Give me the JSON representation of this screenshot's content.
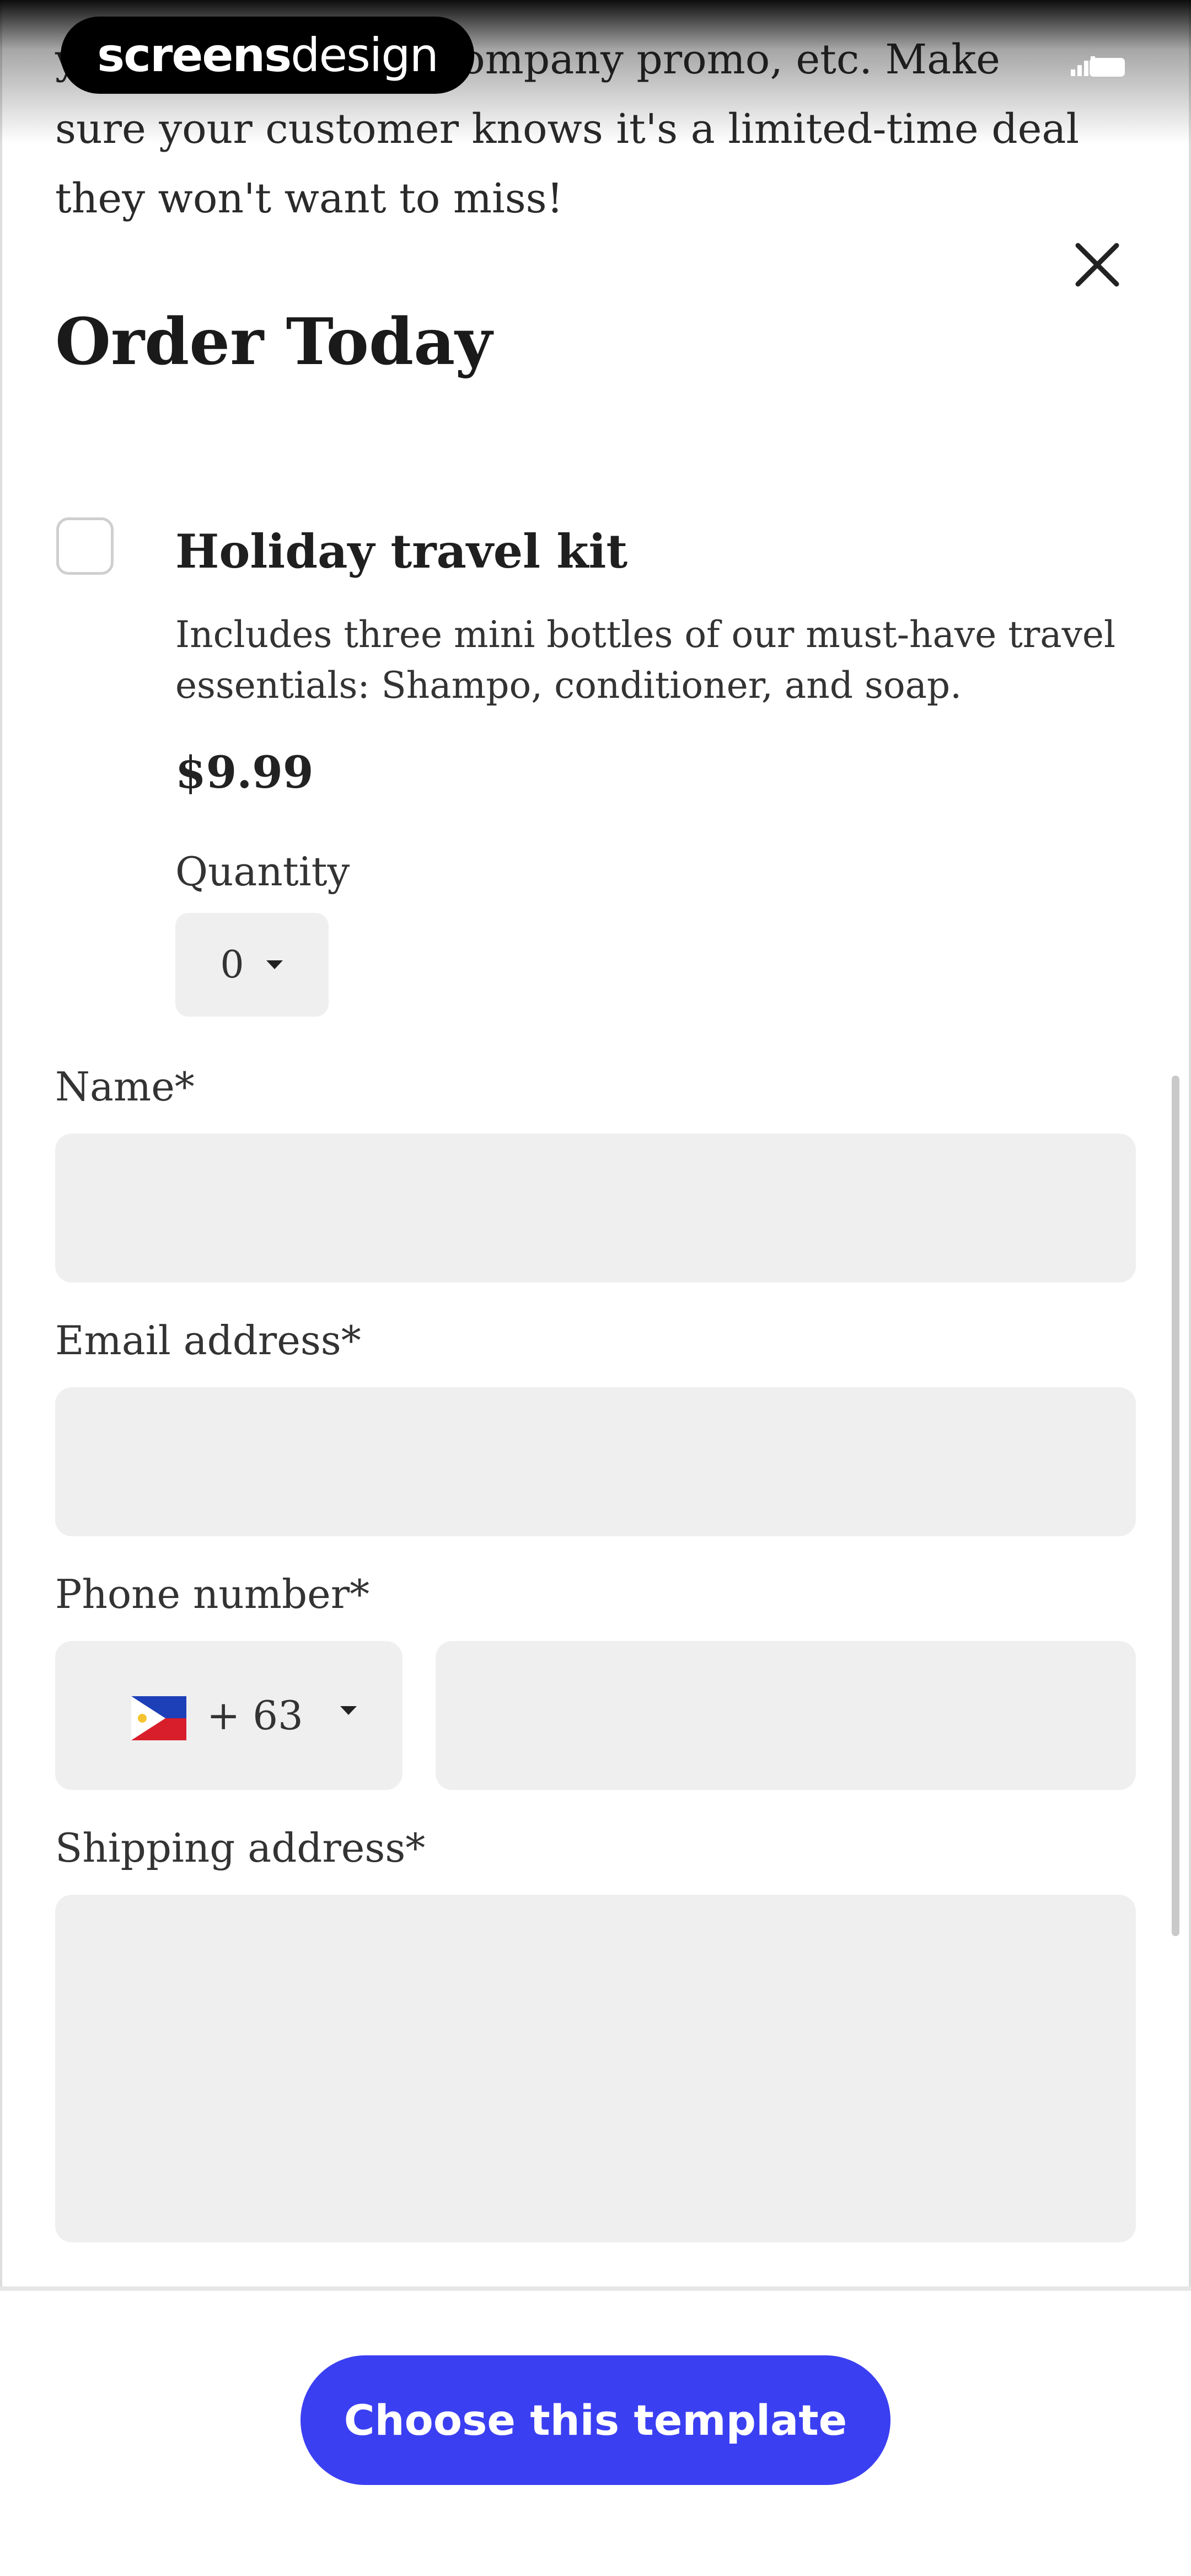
{
  "watermark": {
    "bold": "screens",
    "light": "design"
  },
  "intro": {
    "text": "your special offer, company promo, etc. Make sure your customer knows it's a limited-time deal they won't want to miss!"
  },
  "modal": {
    "title": "Order Today",
    "close_icon": "close-icon"
  },
  "product": {
    "title": "Holiday travel kit",
    "description": "Includes three mini bottles of our must-have travel essentials: Shampo, conditioner, and soap.",
    "price": "$9.99",
    "quantity_label": "Quantity",
    "quantity_value": "0",
    "checked": false
  },
  "form": {
    "name_label": "Name*",
    "email_label": "Email address*",
    "phone_label": "Phone number*",
    "phone_country_code": "+ 63",
    "phone_flag_icon": "philippines-flag-icon",
    "address_label": "Shipping address*"
  },
  "cta": {
    "label": "Choose this template"
  },
  "colors": {
    "accent": "#3b3ff2",
    "field_bg": "#efefef",
    "text": "#222222"
  }
}
